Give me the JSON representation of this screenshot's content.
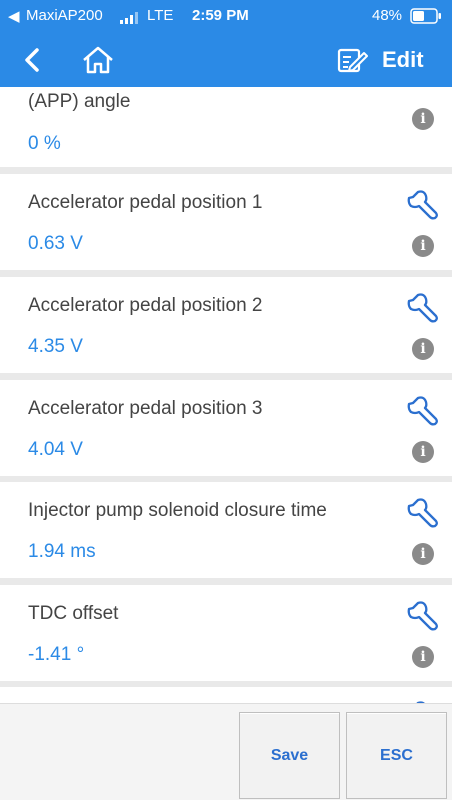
{
  "status": {
    "carrier": "MaxiAP200",
    "network": "LTE",
    "time": "2:59 PM",
    "battery": "48%"
  },
  "nav": {
    "edit_label": "Edit",
    "back_icon": "back-arrow-icon",
    "home_icon": "home-icon",
    "edit_icon": "edit-icon"
  },
  "params": [
    {
      "label": "(APP) angle",
      "value": "0 %"
    },
    {
      "label": "Accelerator pedal position 1",
      "value": "0.63 V"
    },
    {
      "label": "Accelerator pedal position 2",
      "value": "4.35 V"
    },
    {
      "label": "Accelerator pedal position 3",
      "value": "4.04 V"
    },
    {
      "label": "Injector pump solenoid closure time",
      "value": "1.94 ms"
    },
    {
      "label": "TDC offset",
      "value": "-1.41 °"
    }
  ],
  "bottom": {
    "save_label": "Save",
    "esc_label": "ESC"
  },
  "colors": {
    "accent": "#2b8ae6",
    "value_text": "#2b8ae6"
  }
}
